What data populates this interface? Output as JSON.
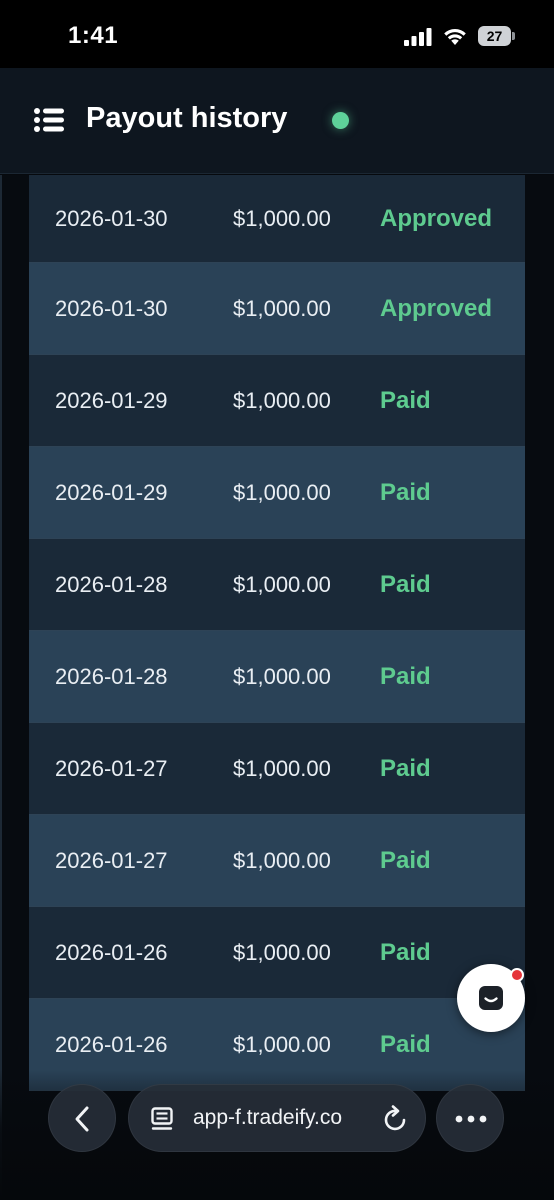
{
  "status_bar": {
    "time": "1:41",
    "battery": "27",
    "icons": [
      "signal-icon",
      "wifi-icon",
      "battery-icon"
    ]
  },
  "header": {
    "title": "Payout history",
    "menu_icon": "menu-icon",
    "status_color": "#5ed199"
  },
  "payouts": [
    {
      "date": "2026-01-30",
      "amount": "$1,000.00",
      "status": "Approved"
    },
    {
      "date": "2026-01-30",
      "amount": "$1,000.00",
      "status": "Approved"
    },
    {
      "date": "2026-01-29",
      "amount": "$1,000.00",
      "status": "Paid"
    },
    {
      "date": "2026-01-29",
      "amount": "$1,000.00",
      "status": "Paid"
    },
    {
      "date": "2026-01-28",
      "amount": "$1,000.00",
      "status": "Paid"
    },
    {
      "date": "2026-01-28",
      "amount": "$1,000.00",
      "status": "Paid"
    },
    {
      "date": "2026-01-27",
      "amount": "$1,000.00",
      "status": "Paid"
    },
    {
      "date": "2026-01-27",
      "amount": "$1,000.00",
      "status": "Paid"
    },
    {
      "date": "2026-01-26",
      "amount": "$1,000.00",
      "status": "Paid"
    },
    {
      "date": "2026-01-26",
      "amount": "$1,000.00",
      "status": "Paid"
    }
  ],
  "colors": {
    "status_green": "#5ecb8f",
    "row_dark": "#1a2938",
    "row_light": "#2a4257",
    "notification": "#e5343a"
  },
  "chat_widget": {
    "icon": "chat-icon",
    "has_notification": true
  },
  "browser_bar": {
    "url": "app-f.tradeify.co",
    "icons": [
      "back-icon",
      "page-icon",
      "reload-icon",
      "more-icon"
    ]
  }
}
